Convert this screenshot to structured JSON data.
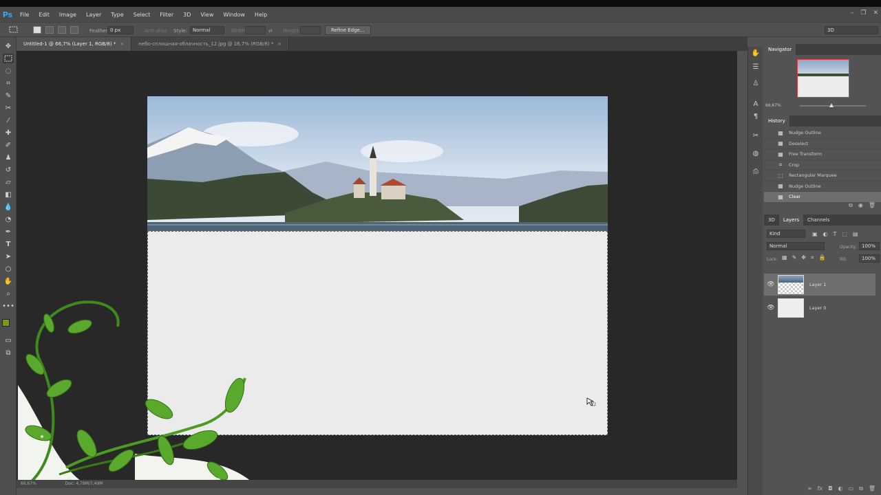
{
  "app": {
    "logo": "Ps"
  },
  "menu": [
    "File",
    "Edit",
    "Image",
    "Layer",
    "Type",
    "Select",
    "Filter",
    "3D",
    "View",
    "Window",
    "Help"
  ],
  "window_controls": {
    "minimize": "–",
    "restore": "❐",
    "close": "✕"
  },
  "options": {
    "feather_label": "Feather:",
    "feather_value": "0 px",
    "antialias_label": "Anti-alias",
    "style_label": "Style:",
    "style_value": "Normal",
    "width_label": "Width:",
    "height_label": "Height:",
    "refine_button": "Refine Edge...",
    "workspace_value": "3D"
  },
  "tabs": [
    {
      "label": "Untitled-1 @ 66,7% (Layer 1, RGB/8) *",
      "close": "×",
      "active": true
    },
    {
      "label": "небо-сплошная-облачность_12.jpg @ 16,7% (RGB/8) *",
      "close": "×",
      "active": false
    }
  ],
  "status": {
    "zoom": "66,67%",
    "doc": "Doc: 4,79M/7,49M"
  },
  "colors": {
    "foreground": "#7a9a1c",
    "background": "#ffffff",
    "accent": "#31a8ff"
  },
  "navigator": {
    "title": "Navigator",
    "zoom": "66,67%"
  },
  "history": {
    "title": "History",
    "items": [
      {
        "label": "Nudge Outline",
        "icon": "history-step-icon"
      },
      {
        "label": "Deselect",
        "icon": "history-step-icon"
      },
      {
        "label": "Free Transform",
        "icon": "history-step-icon"
      },
      {
        "label": "Crop",
        "icon": "crop-icon"
      },
      {
        "label": "Rectangular Marquee",
        "icon": "marquee-icon"
      },
      {
        "label": "Nudge Outline",
        "icon": "history-step-icon"
      },
      {
        "label": "Clear",
        "icon": "history-step-icon"
      }
    ]
  },
  "layers_panel": {
    "tabs": [
      "3D",
      "Layers",
      "Channels"
    ],
    "kind_filter": "Kind",
    "blend_mode": "Normal",
    "opacity_label": "Opacity:",
    "opacity_value": "100%",
    "lock_label": "Lock:",
    "fill_label": "Fill:",
    "fill_value": "100%",
    "layers": [
      {
        "name": "Layer 1",
        "visible": true,
        "selected": true
      },
      {
        "name": "Layer 0",
        "visible": true,
        "selected": false
      }
    ]
  }
}
